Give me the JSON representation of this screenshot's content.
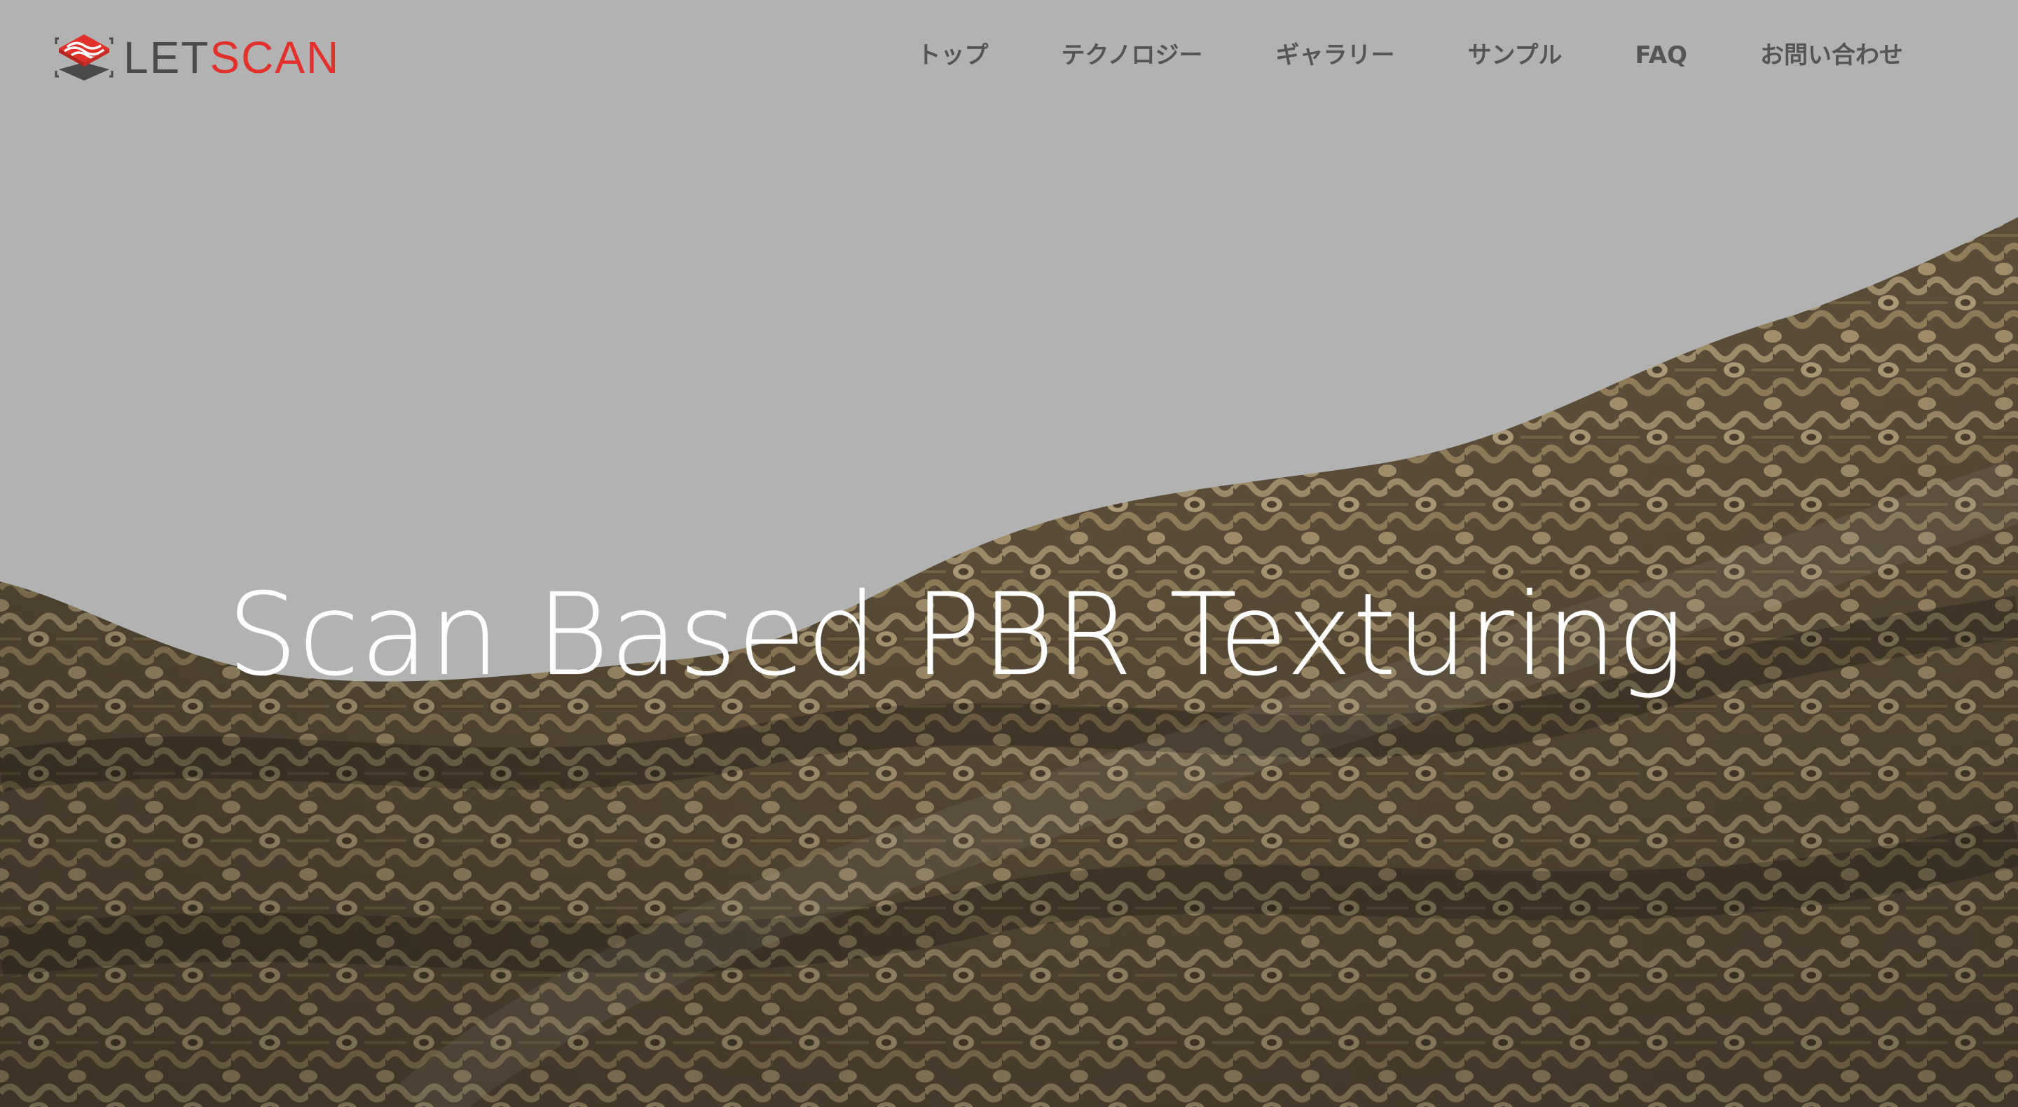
{
  "brand": {
    "name_part1": "LET",
    "name_part2": "SCAN",
    "color_dark": "#4a4a4a",
    "color_accent": "#e2312b"
  },
  "nav": {
    "items": [
      {
        "label": "トップ"
      },
      {
        "label": "テクノロジー"
      },
      {
        "label": "ギャラリー"
      },
      {
        "label": "サンプル"
      },
      {
        "label": "FAQ"
      },
      {
        "label": "お問い合わせ"
      }
    ]
  },
  "hero": {
    "title": "Scan Based PBR Texturing",
    "image": "woven-fabric-scan-render",
    "background_color": "#b2b2b2"
  }
}
